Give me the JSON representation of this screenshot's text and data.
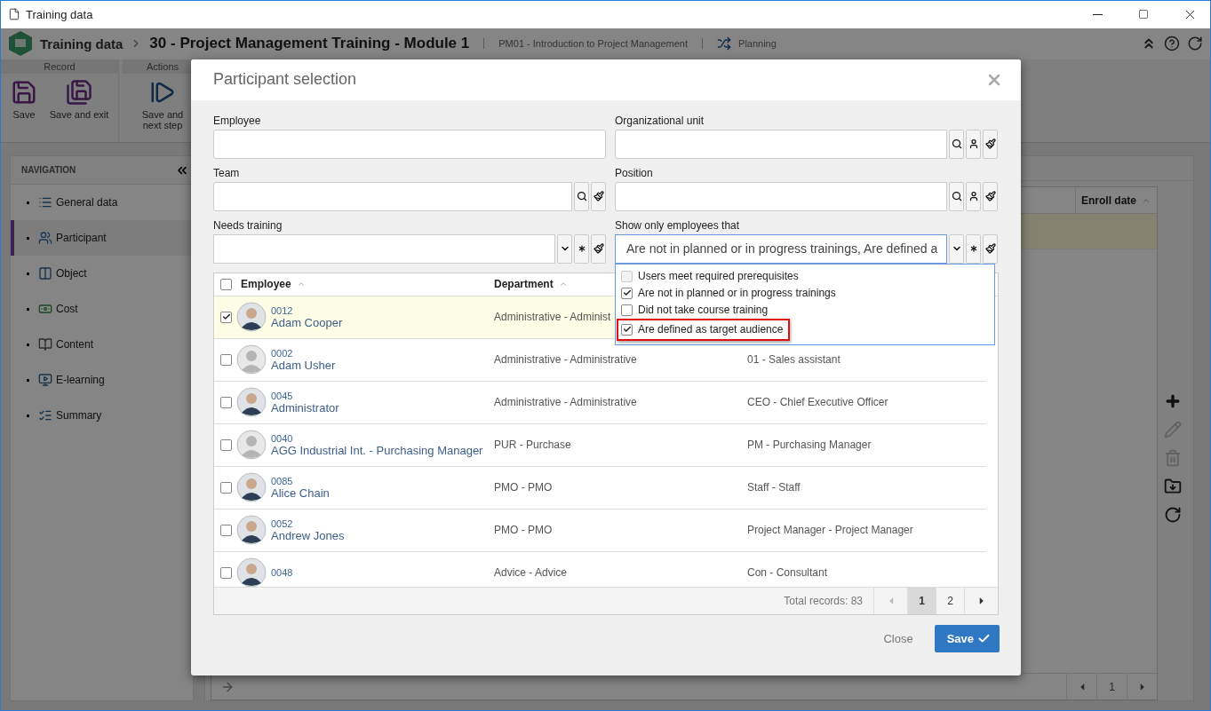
{
  "window": {
    "title": "Training data"
  },
  "header": {
    "module": "Training data",
    "record_title": "30 - Project Management Training - Module 1",
    "object": "PM01 - Introduction to Project Management",
    "step": "Planning"
  },
  "ribbon": [
    {
      "label": "Record",
      "buttons": [
        {
          "label": "Save",
          "kind": "save"
        },
        {
          "label": "Save and exit",
          "kind": "save-exit"
        }
      ]
    },
    {
      "label": "Actions",
      "buttons": [
        {
          "label": "Save and next step",
          "kind": "next"
        }
      ]
    }
  ],
  "navigation": {
    "title": "NAVIGATION",
    "items": [
      {
        "label": "General data",
        "kind": "general",
        "selected": false
      },
      {
        "label": "Participant",
        "kind": "participant",
        "selected": true
      },
      {
        "label": "Object",
        "kind": "object",
        "selected": false
      },
      {
        "label": "Cost",
        "kind": "cost",
        "selected": false
      },
      {
        "label": "Content",
        "kind": "content",
        "selected": false
      },
      {
        "label": "E-learning",
        "kind": "elearning",
        "selected": false
      },
      {
        "label": "Summary",
        "kind": "summary",
        "selected": false
      }
    ]
  },
  "background_table": {
    "columns": [
      {
        "label": "Enroll date",
        "sortable": true
      }
    ],
    "rows": [
      {
        "selected": true
      }
    ],
    "pages": [
      {
        "label": "1"
      }
    ]
  },
  "side_toolbar": [
    {
      "kind": "add",
      "disabled": false
    },
    {
      "kind": "edit",
      "disabled": true
    },
    {
      "kind": "delete",
      "disabled": true
    },
    {
      "kind": "folder",
      "disabled": false
    },
    {
      "kind": "refresh",
      "disabled": false
    }
  ],
  "dialog": {
    "title": "Participant selection",
    "fields": [
      {
        "label": "Employee",
        "kind": "text"
      },
      {
        "label": "Organizational unit",
        "kind": "lookup",
        "buttons": [
          {
            "kind": "search"
          },
          {
            "kind": "person"
          },
          {
            "kind": "clear"
          }
        ]
      },
      {
        "label": "Team",
        "kind": "lookup",
        "buttons": [
          {
            "kind": "search"
          },
          {
            "kind": "clear"
          }
        ]
      },
      {
        "label": "Position",
        "kind": "lookup",
        "buttons": [
          {
            "kind": "search"
          },
          {
            "kind": "person"
          },
          {
            "kind": "clear"
          }
        ]
      },
      {
        "label": "Needs training",
        "kind": "select",
        "buttons": [
          {
            "kind": "caret"
          },
          {
            "kind": "asterisk"
          },
          {
            "kind": "clear"
          }
        ]
      },
      {
        "label": "Show only employees that",
        "kind": "select",
        "value": "Are not in planned or in progress trainings, Are defined a",
        "buttons": [
          {
            "kind": "caret"
          },
          {
            "kind": "asterisk"
          },
          {
            "kind": "clear"
          }
        ],
        "expanded": true
      }
    ],
    "dropdown": {
      "options": [
        {
          "label": "Users meet required prerequisites",
          "checked": false,
          "disabled": true,
          "highlighted": false
        },
        {
          "label": "Are not in planned or in progress trainings",
          "checked": true,
          "disabled": false,
          "highlighted": false
        },
        {
          "label": "Did not take course training",
          "checked": false,
          "disabled": false,
          "highlighted": false
        },
        {
          "label": "Are defined as target audience",
          "checked": true,
          "disabled": false,
          "highlighted": true
        }
      ]
    },
    "table": {
      "all_checked": false,
      "columns": [
        {
          "label": "Employee",
          "sortable": true
        },
        {
          "label": "Department",
          "sortable": true
        }
      ],
      "rows": [
        {
          "code": "0012",
          "name": "Adam Cooper",
          "department": "Administrative - Administ",
          "avatar": {
            "kind": "photo"
          },
          "checked": true
        },
        {
          "code": "0002",
          "name": "Adam Usher",
          "department": "Administrative - Administrative",
          "position": "01 - Sales assistant",
          "avatar": {
            "kind": "default"
          },
          "checked": false
        },
        {
          "code": "0045",
          "name": "Administrator",
          "department": "Administrative - Administrative",
          "position": "CEO - Chief Executive Officer",
          "avatar": {
            "kind": "photo"
          },
          "checked": false
        },
        {
          "code": "0040",
          "name": "AGG Industrial Int. - Purchasing Manager",
          "department": "PUR - Purchase",
          "position": "PM - Purchasing Manager",
          "avatar": {
            "kind": "default"
          },
          "checked": false
        },
        {
          "code": "0085",
          "name": "Alice Chain",
          "department": "PMO - PMO",
          "position": "Staff - Staff",
          "avatar": {
            "kind": "photo"
          },
          "checked": false
        },
        {
          "code": "0052",
          "name": "Andrew Jones",
          "department": "PMO - PMO",
          "position": "Project Manager - Project Manager",
          "avatar": {
            "kind": "photo"
          },
          "checked": false
        },
        {
          "code": "0048",
          "department": "Advice - Advice",
          "position": "Con - Consultant",
          "avatar": {
            "kind": "photo"
          },
          "checked": false
        }
      ],
      "footer": {
        "total": "Total records: 83",
        "pages": [
          {
            "label": "1",
            "selected": true
          },
          {
            "label": "2",
            "selected": false
          }
        ]
      }
    },
    "buttons": [
      {
        "label": "Close",
        "kind": "secondary"
      },
      {
        "label": "Save",
        "kind": "primary"
      }
    ]
  }
}
